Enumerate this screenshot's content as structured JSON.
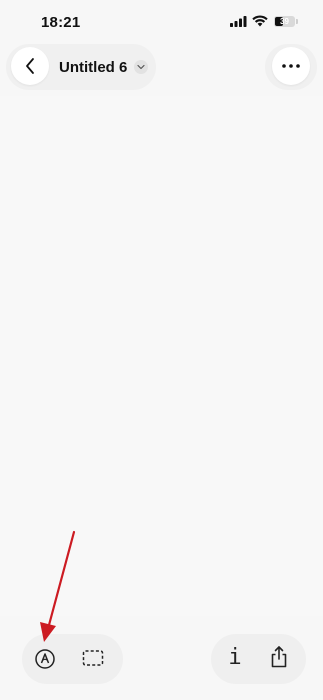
{
  "status_bar": {
    "time": "18:21",
    "battery_level": "39",
    "icons": [
      "cellular-signal-icon",
      "wifi-icon",
      "battery-icon"
    ]
  },
  "header": {
    "title": "Untitled 6",
    "back_icon": "chevron-left-icon",
    "title_menu_icon": "chevron-down-icon",
    "more_icon": "ellipsis-icon"
  },
  "toolbar": {
    "left_tools": [
      "pen-tool-icon",
      "selection-tool-icon"
    ],
    "right_tools": [
      "info-icon",
      "share-icon"
    ],
    "info_glyph": "i"
  },
  "annotation": {
    "arrow_color": "#cc1b22",
    "points_to": "pen-tool"
  },
  "colors": {
    "background": "#f7f7f7",
    "toolbar_pill": "#efefef",
    "button_fill": "#ffffff"
  }
}
